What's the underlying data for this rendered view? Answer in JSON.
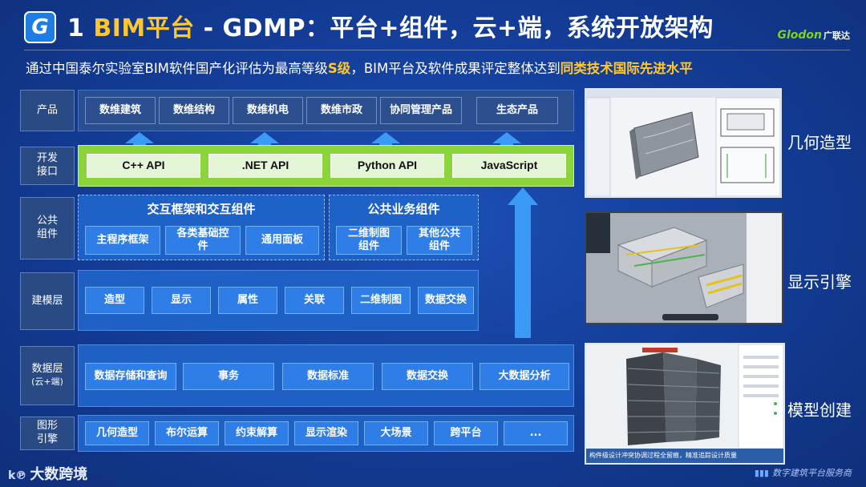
{
  "header": {
    "logo_letter": "G",
    "title_prefix": "1 ",
    "title_highlight": "BIM平台",
    "title_rest": " - GDMP：平台+组件，云+端，系统开放架构",
    "brand_name": "Glodon",
    "brand_cn": "广联达"
  },
  "subtitle": {
    "part1": "通过中国泰尔实验室BIM软件国产化评估为最高等级",
    "highlight1": "S级",
    "part2": "，BIM平台及软件成果评定整体达到",
    "highlight2": "同类技术国际先进水平"
  },
  "layers": {
    "product": {
      "label": "产品",
      "items": [
        "数维建筑",
        "数维结构",
        "数维机电",
        "数维市政",
        "协同管理产品",
        "生态产品"
      ]
    },
    "api": {
      "label": "开发\n接口",
      "items": [
        "C++ API",
        ".NET API",
        "Python API",
        "JavaScript"
      ]
    },
    "common": {
      "label": "公共\n组件",
      "group1_title": "交互框架和交互组件",
      "group1_items": [
        "主程序框架",
        "各类基础控\n件",
        "通用面板"
      ],
      "group2_title": "公共业务组件",
      "group2_items": [
        "二维制图\n组件",
        "其他公共\n组件"
      ]
    },
    "modeling": {
      "label": "建模层",
      "items": [
        "造型",
        "显示",
        "属性",
        "关联",
        "二维制图",
        "数据交换"
      ]
    },
    "data": {
      "label": "数据层",
      "sublabel": "(云+端)",
      "items": [
        "数据存储和查询",
        "事务",
        "数据标准",
        "数据交换",
        "大数据分析"
      ]
    },
    "graphics": {
      "label": "图形\n引擎",
      "items": [
        "几何造型",
        "布尔运算",
        "约束解算",
        "显示渲染",
        "大场景",
        "跨平台",
        "..."
      ]
    }
  },
  "showcase": [
    {
      "caption": "几何造型"
    },
    {
      "caption": "显示引擎"
    },
    {
      "caption": "模型创建"
    }
  ],
  "screenshot3_caption": "构件级设计冲突协调过程全留痕，精准追踪设计质量",
  "footer": {
    "left": "大数跨境",
    "right": "数字建筑平台服务商"
  },
  "colors": {
    "accent_yellow": "#ffc72c",
    "brand_green": "#7ed321",
    "chip_blue": "#2f7de6",
    "api_green": "#8bd43a"
  }
}
